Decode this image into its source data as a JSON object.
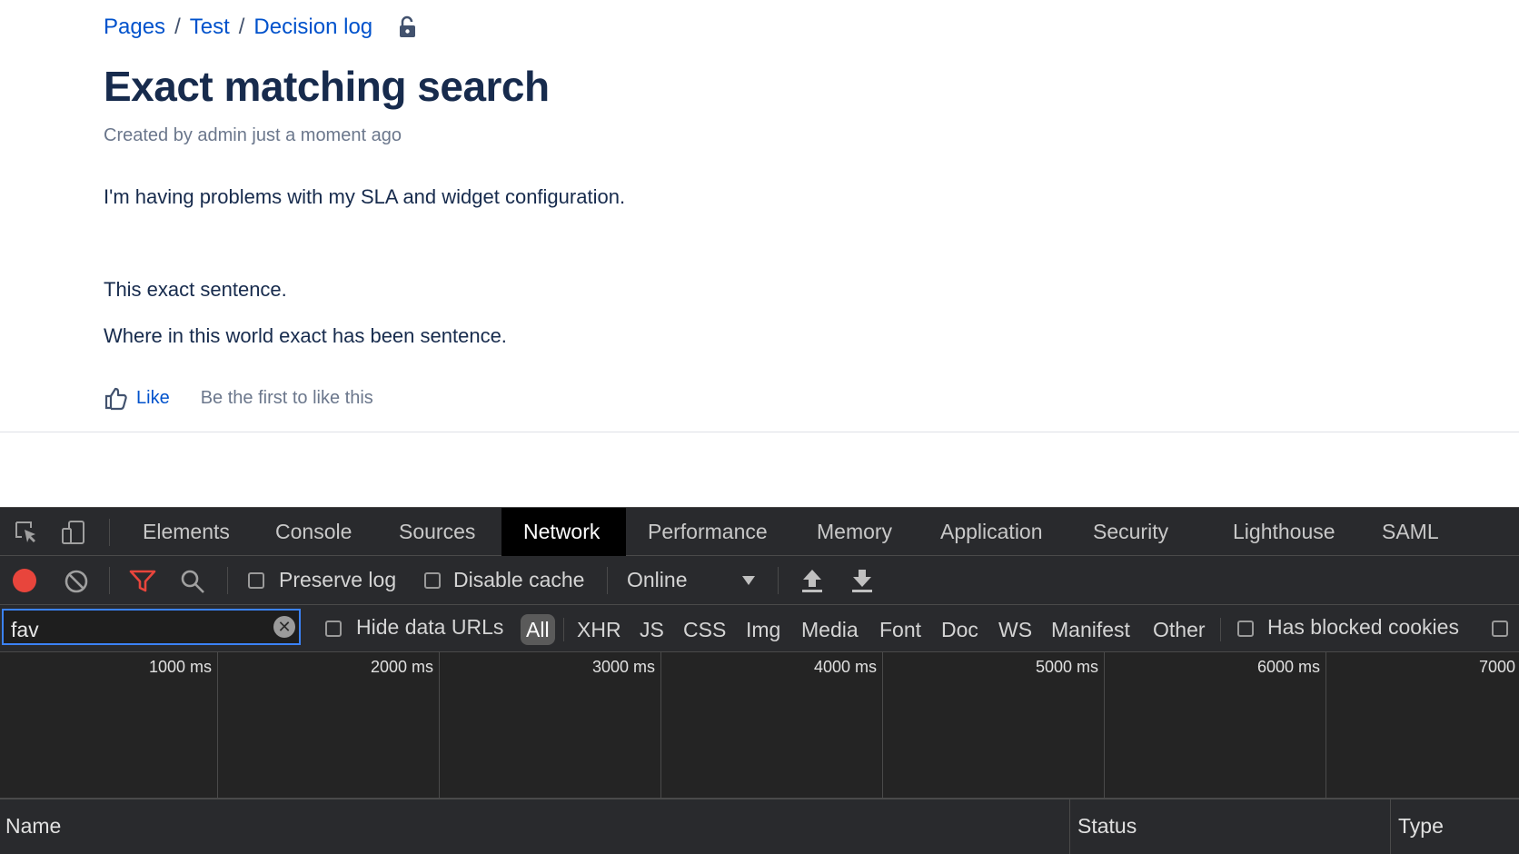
{
  "breadcrumb": {
    "items": [
      "Pages",
      "Test",
      "Decision log"
    ],
    "separator": "/"
  },
  "page": {
    "title": "Exact matching search",
    "byline": "Created by admin just a moment ago",
    "paragraphs": [
      "I'm having problems with my SLA and widget configuration.",
      "This exact sentence.",
      "Where in this world exact has been sentence."
    ],
    "like_label": "Like",
    "like_status": "Be the first to like this"
  },
  "devtools": {
    "tabs": [
      "Elements",
      "Console",
      "Sources",
      "Network",
      "Performance",
      "Memory",
      "Application",
      "Security",
      "Lighthouse",
      "SAML"
    ],
    "active_tab": "Network",
    "toolbar": {
      "preserve_log": "Preserve log",
      "disable_cache": "Disable cache",
      "throttling": "Online"
    },
    "filter": {
      "value": "fav",
      "hide_data_urls": "Hide data URLs",
      "types": [
        "All",
        "XHR",
        "JS",
        "CSS",
        "Img",
        "Media",
        "Font",
        "Doc",
        "WS",
        "Manifest",
        "Other"
      ],
      "active_type": "All",
      "has_blocked_cookies": "Has blocked cookies"
    },
    "timeline_ticks": [
      "1000 ms",
      "2000 ms",
      "3000 ms",
      "4000 ms",
      "5000 ms",
      "6000 ms",
      "7000"
    ],
    "columns": [
      "Name",
      "Status",
      "Type"
    ]
  },
  "colors": {
    "link": "#0052cc",
    "heading": "#172b4d",
    "record": "#e8453c",
    "filter_active": "#e8453c",
    "focus": "#3b82f6"
  }
}
